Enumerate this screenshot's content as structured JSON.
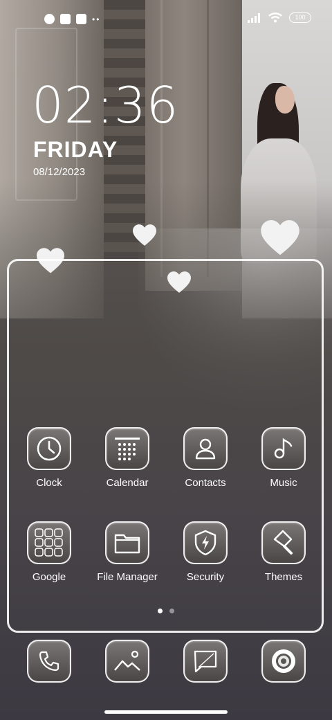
{
  "status_bar": {
    "battery": "100",
    "left_icons": [
      "app-notification-icon",
      "square-notification-icon",
      "upload-notification-icon"
    ],
    "right_icons": [
      "signal-icon",
      "wifi-icon",
      "battery-icon"
    ]
  },
  "lock_clock": {
    "time": "02:36",
    "day": "FRIDAY",
    "date": "08/12/2023"
  },
  "apps": [
    {
      "label": "Clock",
      "icon": "clock-icon"
    },
    {
      "label": "Calendar",
      "icon": "calendar-icon"
    },
    {
      "label": "Contacts",
      "icon": "contacts-icon"
    },
    {
      "label": "Music",
      "icon": "music-icon"
    },
    {
      "label": "Google",
      "icon": "google-folder-icon"
    },
    {
      "label": "File Manager",
      "icon": "folder-icon"
    },
    {
      "label": "Security",
      "icon": "shield-icon"
    },
    {
      "label": "Themes",
      "icon": "paint-brush-icon"
    }
  ],
  "dock": [
    {
      "icon": "phone-icon"
    },
    {
      "icon": "gallery-icon"
    },
    {
      "icon": "messages-icon"
    },
    {
      "icon": "camera-icon"
    }
  ],
  "pagination": {
    "current": 1,
    "total": 2
  },
  "colors": {
    "text": "#ffffff",
    "icon_bg_top": "#7a7676",
    "icon_bg_bottom": "#4a4646",
    "frame_border": "#ffffff"
  }
}
